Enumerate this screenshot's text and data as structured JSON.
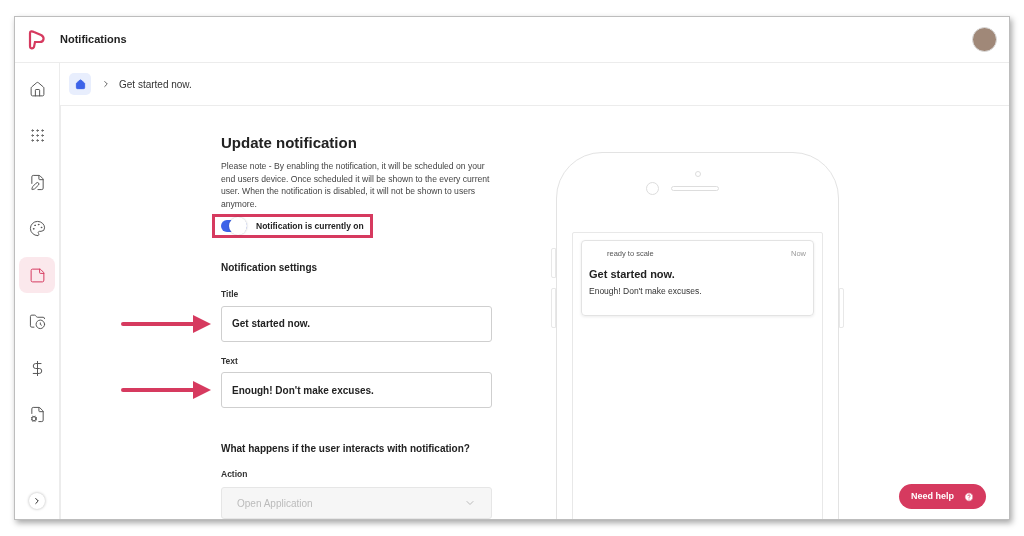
{
  "header": {
    "title": "Notifications"
  },
  "sidebar": {
    "items": [
      {
        "kind": "home",
        "selected": false
      },
      {
        "kind": "grid",
        "selected": false
      },
      {
        "kind": "file-edit",
        "selected": false
      },
      {
        "kind": "palette",
        "selected": false
      },
      {
        "kind": "notes",
        "selected": true
      },
      {
        "kind": "folder",
        "selected": false
      },
      {
        "kind": "dollar",
        "selected": false
      },
      {
        "kind": "file-settings",
        "selected": false
      }
    ]
  },
  "breadcrumb": {
    "items": [
      "Get started now."
    ]
  },
  "form": {
    "heading": "Update notification",
    "note": "Please note - By enabling the notification, it will be scheduled on your end users device. Once scheduled it will be shown to the every current user. When the notification is disabled, it will not be shown to users anymore.",
    "toggle": {
      "label": "Notification is currently on",
      "on": true,
      "highlighted": true
    },
    "settings_heading": "Notification settings",
    "fields": [
      {
        "label": "Title",
        "value": "Get started now.",
        "arrow": true
      },
      {
        "label": "Text",
        "value": "Enough! Don't make excuses.",
        "arrow": true
      }
    ],
    "interaction_heading": "What happens if the user interacts with notification?",
    "action": {
      "label": "Action",
      "value": "Open Application",
      "disabled": true
    }
  },
  "preview": {
    "app_name": "ready to scale",
    "time": "Now",
    "title": "Get started now.",
    "body": "Enough! Don't make excuses."
  },
  "help_button": "Need help"
}
